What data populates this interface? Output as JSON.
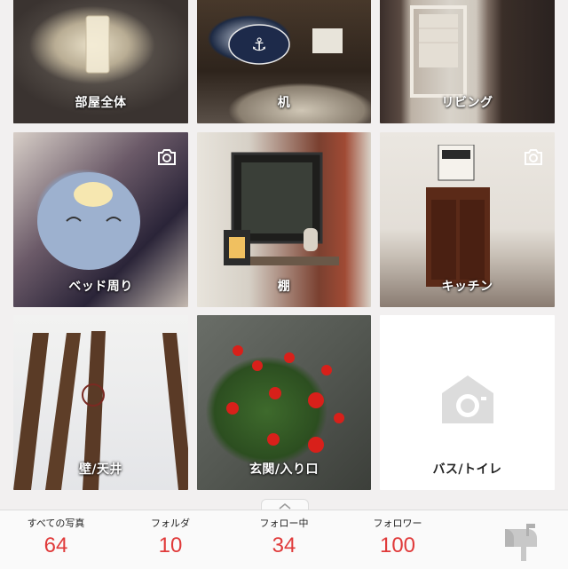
{
  "tiles": [
    {
      "label": "部屋全体",
      "camera_badge": false
    },
    {
      "label": "机",
      "camera_badge": false
    },
    {
      "label": "リビング",
      "camera_badge": false
    },
    {
      "label": "ベッド周り",
      "camera_badge": true
    },
    {
      "label": "棚",
      "camera_badge": false
    },
    {
      "label": "キッチン",
      "camera_badge": true
    },
    {
      "label": "壁/天井",
      "camera_badge": false
    },
    {
      "label": "玄関/入り口",
      "camera_badge": false
    },
    {
      "label": "バス/トイレ",
      "camera_badge": false,
      "empty": true
    }
  ],
  "stats": [
    {
      "label": "すべての写真",
      "value": "64"
    },
    {
      "label": "フォルダ",
      "value": "10"
    },
    {
      "label": "フォロー中",
      "value": "34"
    },
    {
      "label": "フォロワー",
      "value": "100"
    }
  ],
  "icons": {
    "camera_badge": "camera-icon",
    "empty_placeholder": "home-camera-icon",
    "handle": "chevron-up-icon",
    "mailbox": "mailbox-icon"
  },
  "colors": {
    "stat_number": "#e03a3a",
    "background": "#f2f0f0"
  }
}
